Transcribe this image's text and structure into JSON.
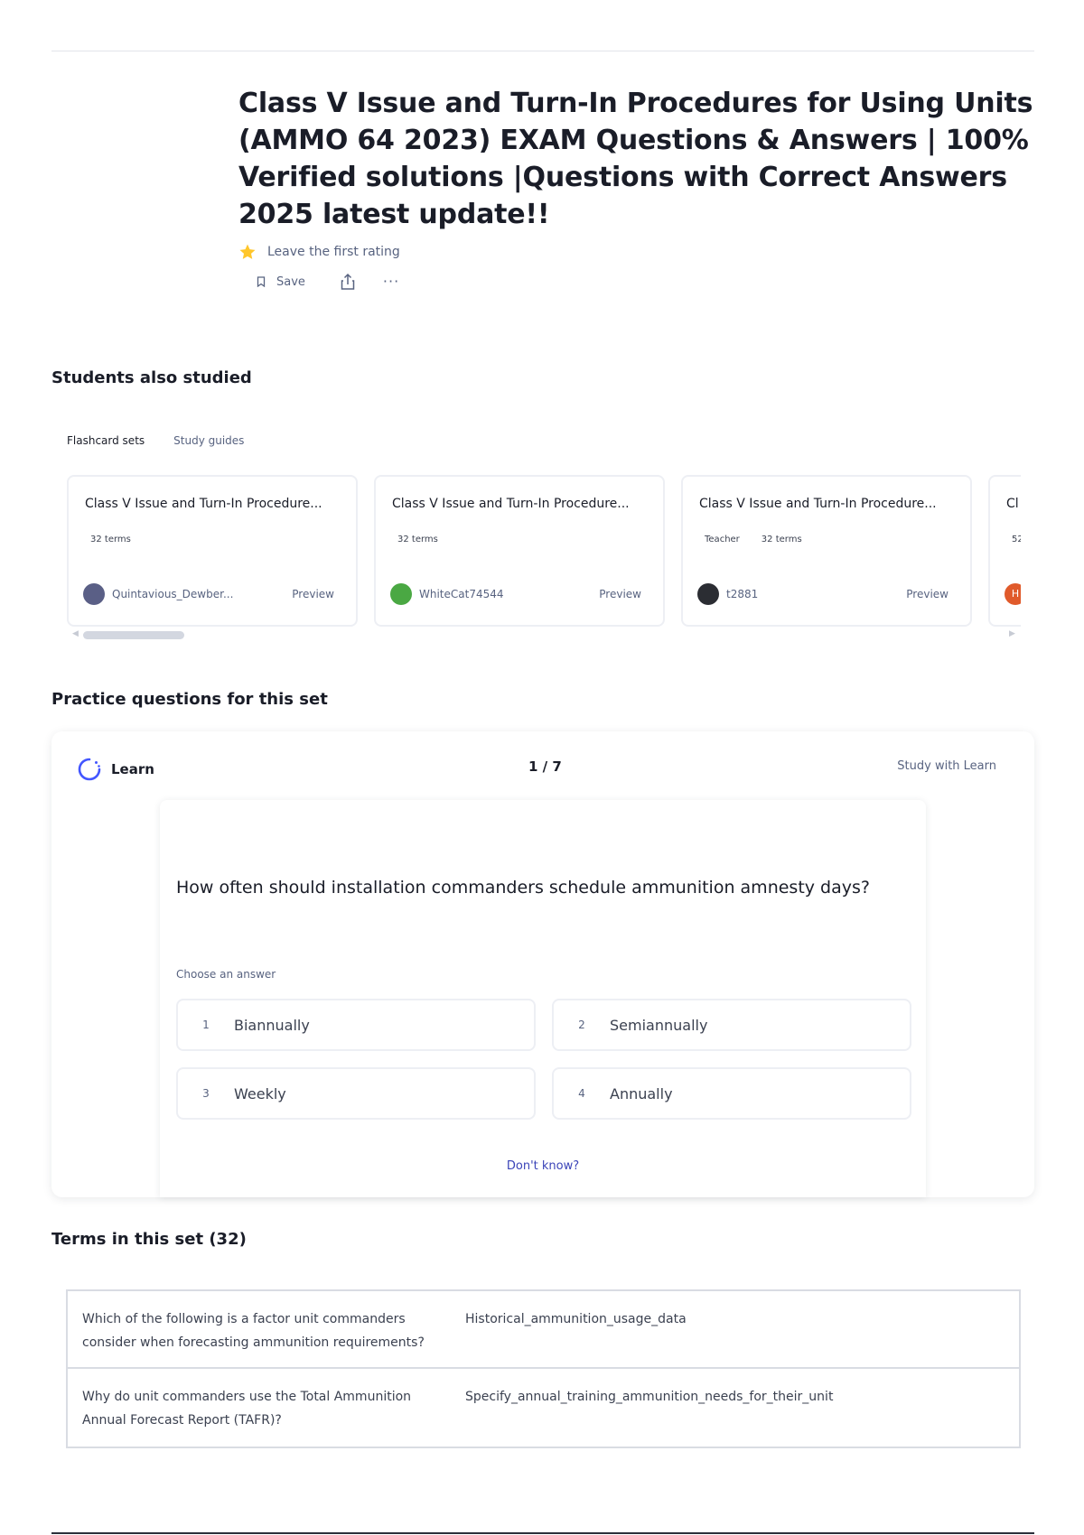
{
  "header": {
    "title": "Class V Issue and Turn-In Procedures for Using Units (AMMO 64 2023) EXAM Questions & Answers | 100% Verified solutions |Questions with Correct Answers 2025 latest update!!",
    "rating_text": "Leave the first rating",
    "save_label": "Save",
    "more_label": "···"
  },
  "students_also_studied": {
    "heading": "Students also studied",
    "tabs": [
      {
        "label": "Flashcard sets",
        "active": true
      },
      {
        "label": "Study guides",
        "active": false
      }
    ],
    "cards": [
      {
        "title": "Class V Issue and Turn-In Procedure...",
        "role": "",
        "terms": "32 terms",
        "user": "Quintavious_Dewber...",
        "preview": "Preview",
        "avatar_color": "#5a5f86"
      },
      {
        "title": "Class V Issue and Turn-In Procedure...",
        "role": "",
        "terms": "32 terms",
        "user": "WhiteCat74544",
        "preview": "Preview",
        "avatar_color": "#4aa843"
      },
      {
        "title": "Class V Issue and Turn-In Procedure...",
        "role": "Teacher",
        "terms": "32 terms",
        "user": "t2881",
        "preview": "Preview",
        "avatar_color": "#2b2d33"
      },
      {
        "title": "Cl",
        "role": "",
        "terms": "52",
        "user": "",
        "preview": "",
        "avatar_color": "#e05a2b",
        "avatar_letter": "H"
      }
    ]
  },
  "practice": {
    "heading": "Practice questions for this set",
    "mode_label": "Learn",
    "progress": "1 / 7",
    "study_with_learn": "Study with Learn",
    "question": "How often should installation commanders schedule ammunition amnesty days?",
    "choose_label": "Choose an answer",
    "answers": [
      {
        "num": "1",
        "text": "Biannually"
      },
      {
        "num": "2",
        "text": "Semiannually"
      },
      {
        "num": "3",
        "text": "Weekly"
      },
      {
        "num": "4",
        "text": "Annually"
      }
    ],
    "dont_know": "Don't know?",
    "accent_color": "#4255ff"
  },
  "terms": {
    "heading": "Terms in this set (32)",
    "rows": [
      {
        "question": "Which of the following is a factor unit commanders consider when forecasting ammunition requirements?",
        "answer": "Historical_ammunition_usage_data"
      },
      {
        "question": "Why do unit commanders use the Total Ammunition Annual Forecast Report (TAFR)?",
        "answer": "Specify_annual_training_ammunition_needs_for_their_unit"
      }
    ]
  }
}
